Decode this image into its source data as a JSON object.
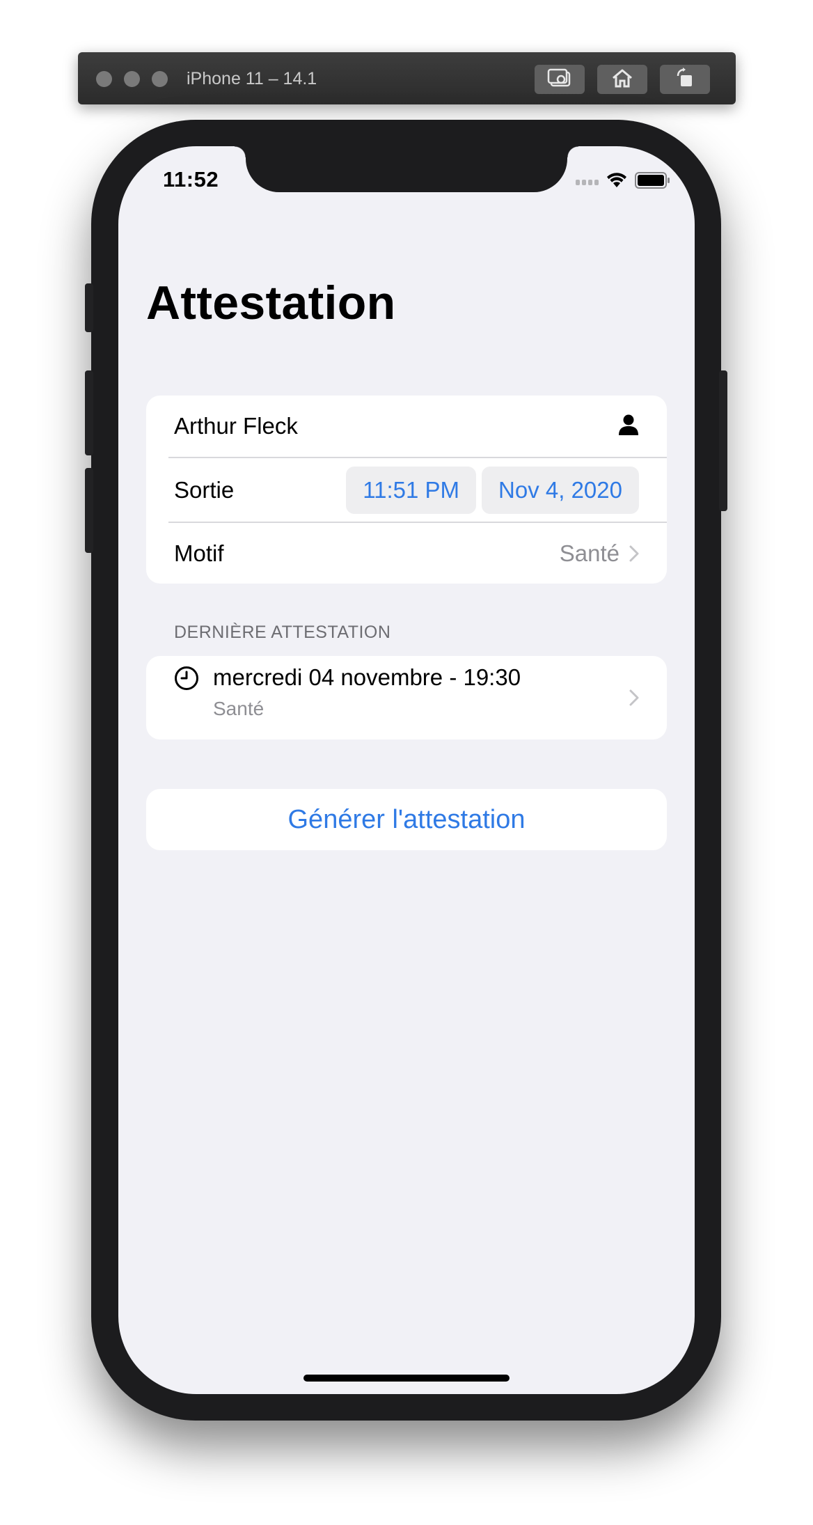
{
  "simulator": {
    "title": "iPhone 11 – 14.1",
    "buttons": [
      "screenshot-icon",
      "home-icon",
      "rotate-icon"
    ]
  },
  "status_bar": {
    "time": "11:52",
    "icons": [
      "cellular-signal-icon",
      "wifi-icon",
      "battery-icon"
    ]
  },
  "page": {
    "title": "Attestation"
  },
  "form": {
    "name": "Arthur Fleck",
    "name_icon": "person-icon",
    "exit_label": "Sortie",
    "exit_time": "11:51 PM",
    "exit_date": "Nov 4, 2020",
    "reason_label": "Motif",
    "reason_value": "Santé"
  },
  "last_attestation": {
    "header": "DERNIÈRE ATTESTATION",
    "title": "mercredi 04 novembre - 19:30",
    "subtitle": "Santé",
    "icon": "clock-icon"
  },
  "actions": {
    "generate_label": "Générer l'attestation"
  },
  "colors": {
    "accent": "#2f7ae5",
    "background": "#f1f1f6",
    "secondary_text": "#8e8e93"
  }
}
